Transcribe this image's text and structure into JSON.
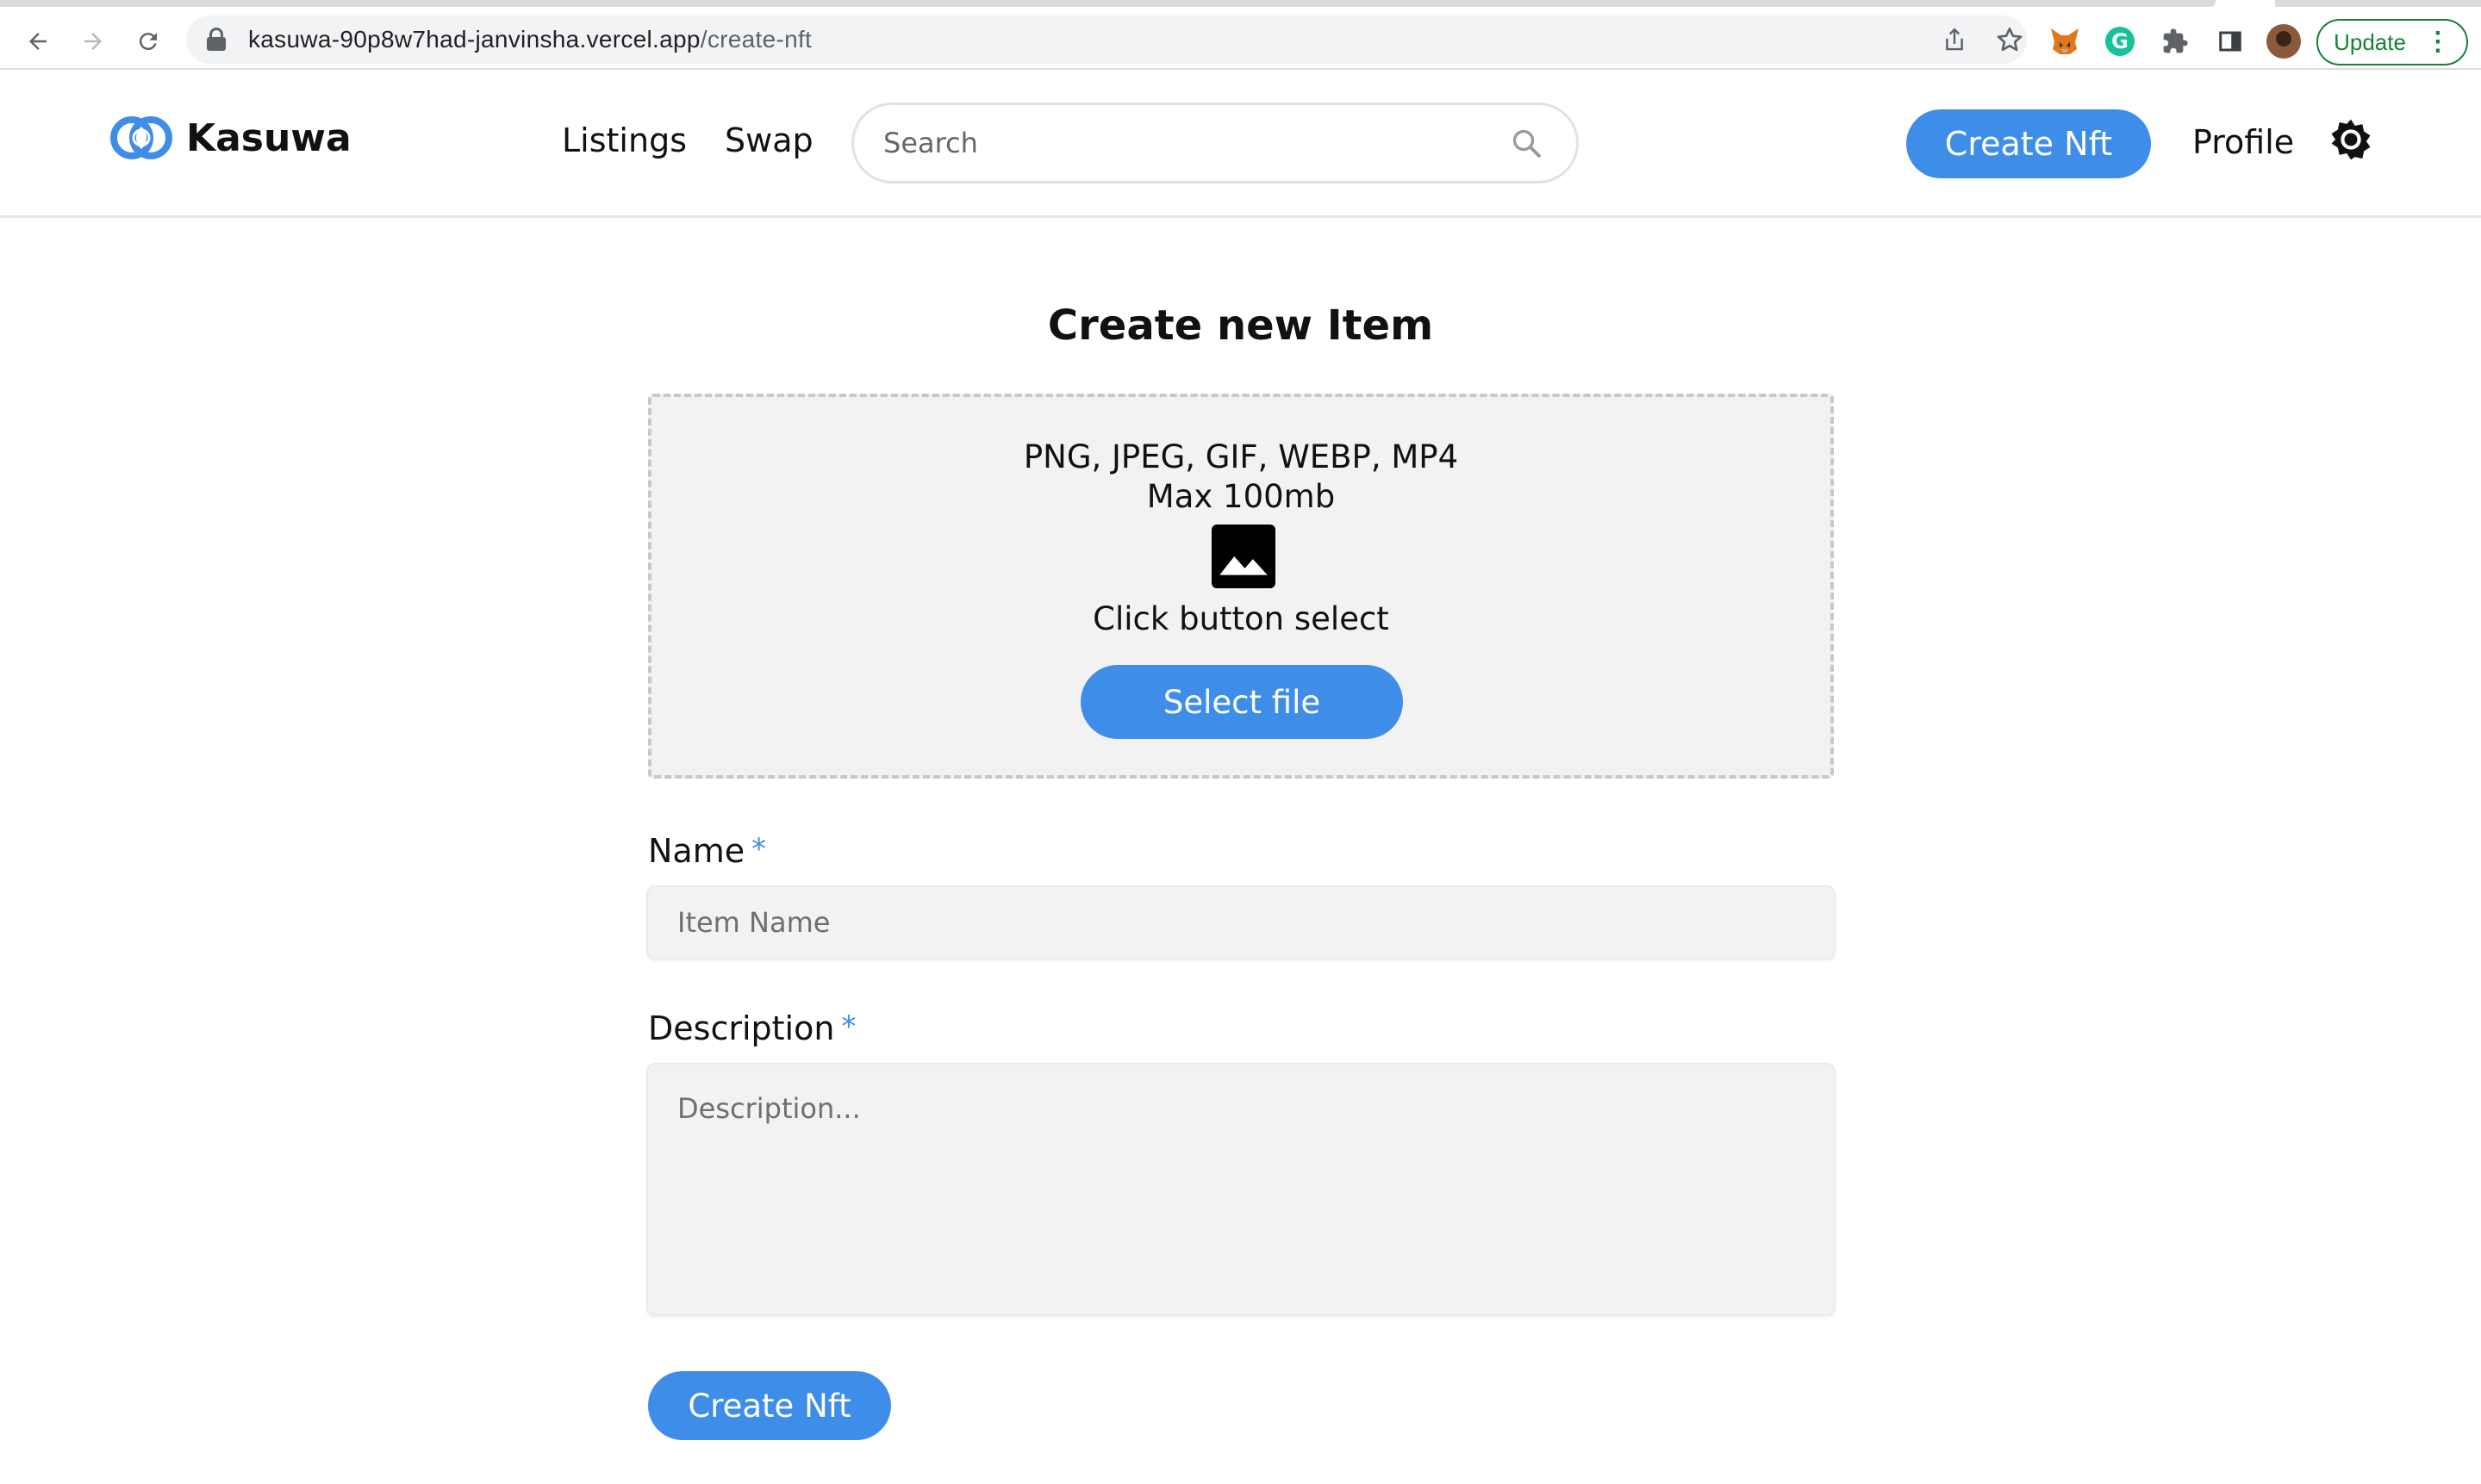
{
  "browser": {
    "url_host": "kasuwa-90p8w7had-janvinsha.vercel.app",
    "url_path": "/create-nft",
    "update_label": "Update"
  },
  "header": {
    "brand": "Kasuwa",
    "nav": {
      "listings": "Listings",
      "swap": "Swap"
    },
    "search_placeholder": "Search",
    "create_nft_label": "Create Nft",
    "profile_label": "Profile"
  },
  "form": {
    "title": "Create new Item",
    "dropzone": {
      "formats": "PNG, JPEG, GIF, WEBP, MP4",
      "max_size": "Max 100mb",
      "hint": "Click button select",
      "select_label": "Select file"
    },
    "name": {
      "label": "Name",
      "required_mark": "*",
      "placeholder": "Item Name",
      "value": ""
    },
    "description": {
      "label": "Description",
      "required_mark": "*",
      "placeholder": "Description...",
      "value": ""
    },
    "submit_label": "Create Nft"
  },
  "colors": {
    "accent": "#3e8ee9",
    "field_bg": "#f2f2f2",
    "update_green": "#188038"
  },
  "icons": [
    "back-arrow-icon",
    "forward-arrow-icon",
    "reload-icon",
    "lock-icon",
    "share-icon",
    "bookmark-star-icon",
    "metamask-fox-icon",
    "grammarly-icon",
    "extensions-puzzle-icon",
    "side-panel-icon",
    "kasuwa-logo-icon",
    "search-icon",
    "theme-toggle-icon",
    "image-placeholder-icon"
  ]
}
